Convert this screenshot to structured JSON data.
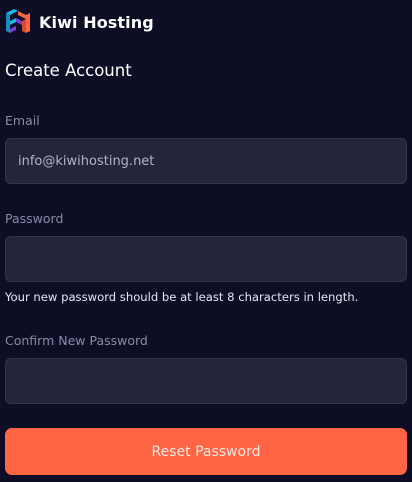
{
  "brand": {
    "name": "Kiwi Hosting",
    "logo_icon": "kiwi-hosting-logo-icon",
    "logo_colors": [
      "#1fb6e8",
      "#ff6544",
      "#7a3ccf"
    ]
  },
  "form": {
    "title": "Create Account",
    "email": {
      "label": "Email",
      "value": "info@kiwihosting.net",
      "placeholder": ""
    },
    "password": {
      "label": "Password",
      "value": "",
      "helper": "Your new password should be at least 8 characters in length."
    },
    "confirm_password": {
      "label": "Confirm New Password",
      "value": ""
    },
    "submit_label": "Reset Password"
  },
  "colors": {
    "background": "#0d0d26",
    "input_background": "#24243a",
    "accent": "#ff6544"
  }
}
